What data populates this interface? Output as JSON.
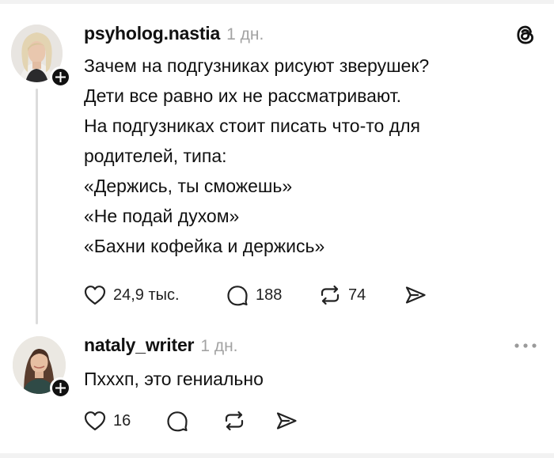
{
  "posts": [
    {
      "username": "psyholog.nastia",
      "time": "1 дн.",
      "lines": [
        "Зачем на подгузниках рисуют зверушек?",
        "Дети все равно их не рассматривают.",
        "На подгузниках стоит писать что-то для",
        "родителей, типа:",
        "«Держись, ты сможешь»",
        "«Не подай духом»",
        "«Бахни кофейка и держись»"
      ],
      "likes": "24,9 тыс.",
      "replies": "188",
      "reposts": "74"
    },
    {
      "username": "nataly_writer",
      "time": "1 дн.",
      "text": "Пхххп, это гениально",
      "likes": "16"
    }
  ],
  "icons": {
    "logo": "threads-logo-icon",
    "more": "more-options-icon",
    "like": "heart-icon",
    "reply": "comment-bubble-icon",
    "repost": "repost-icon",
    "share": "share-send-icon",
    "follow": "plus-icon"
  }
}
